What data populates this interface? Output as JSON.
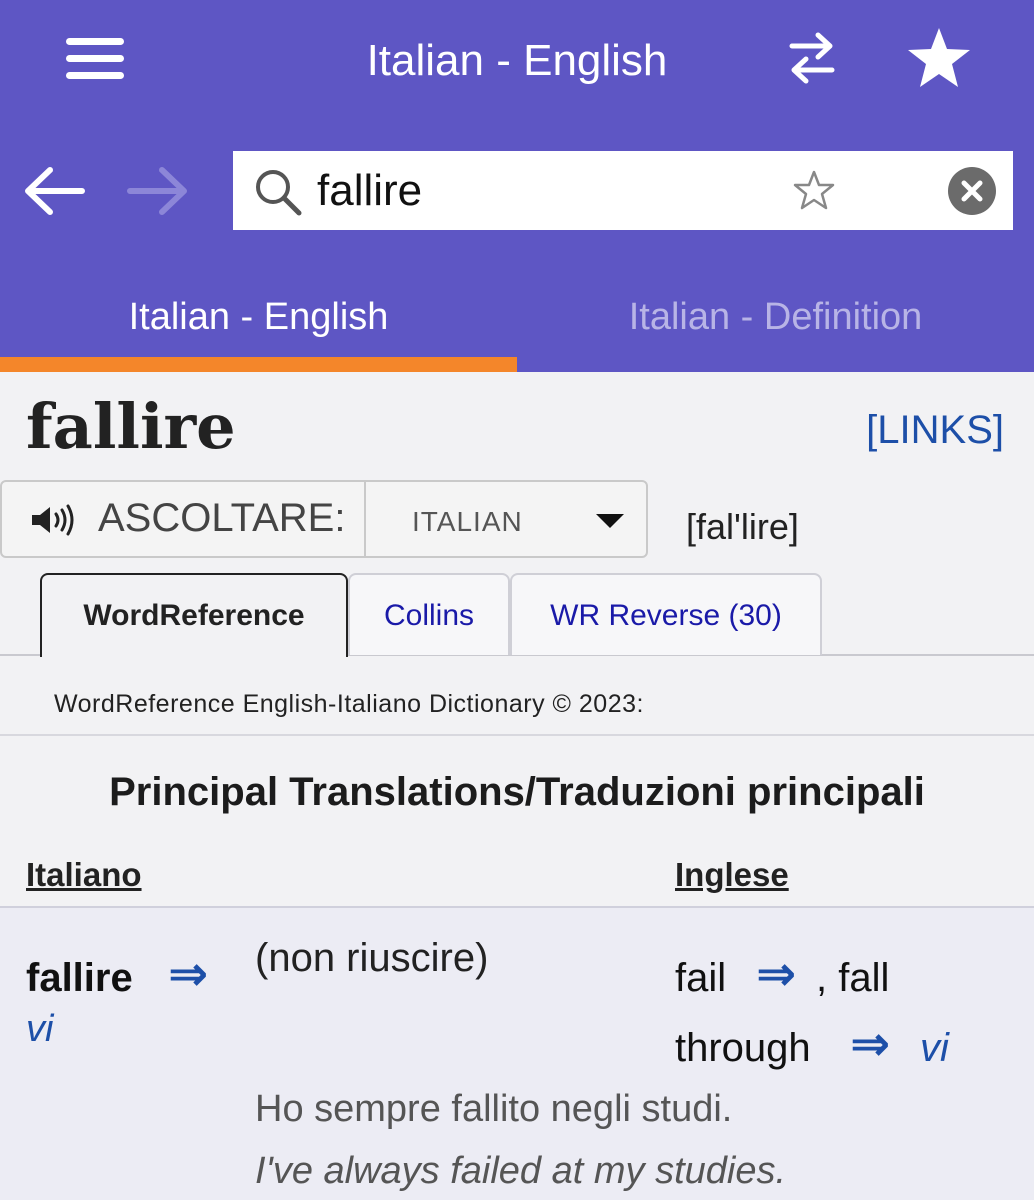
{
  "header": {
    "title": "Italian - English",
    "menu_icon": "hamburger-menu-icon",
    "swap_icon": "swap-direction-icon",
    "favorites_icon": "star-icon",
    "colors": {
      "header_bg": "#5e56c4",
      "tab_indicator": "#f4862a",
      "link": "#1d4fa8"
    }
  },
  "nav": {
    "back_icon": "arrow-left-icon",
    "forward_icon": "arrow-right-icon"
  },
  "search": {
    "value": "fallire",
    "placeholder": "",
    "search_icon": "search-icon",
    "bookmark_icon": "star-outline-icon",
    "clear_icon": "clear-icon"
  },
  "tabs": [
    {
      "label": "Italian - English",
      "active": true
    },
    {
      "label": "Italian - Definition",
      "active": false
    }
  ],
  "entry_header": {
    "headword": "fallire",
    "links_label": "[LINKS]",
    "listen_label": "ASCOLTARE:",
    "speaker_icon": "speaker-icon",
    "language_selected": "ITALIAN",
    "pronunciation": "[fal'lire]"
  },
  "dict_tabs": [
    {
      "label": "WordReference",
      "active": true
    },
    {
      "label": "Collins",
      "active": false
    },
    {
      "label": "WR Reverse (30)",
      "active": false
    }
  ],
  "dictionary": {
    "copyright": "WordReference English-Italiano Dictionary © 2023:",
    "section_title": "Principal Translations/Traduzioni principali",
    "col_source": "Italiano",
    "col_target": "Inglese",
    "rows": [
      {
        "word": "fallire",
        "arrow": "⇒",
        "pos": "vi",
        "sense": "(non riuscire)",
        "translation_1": "fail",
        "translation_2": ", fall",
        "translation_3": "through",
        "translation_pos": "vi",
        "example_it": "Ho sempre fallito negli studi.",
        "example_en": "I've always failed at my studies."
      }
    ]
  }
}
